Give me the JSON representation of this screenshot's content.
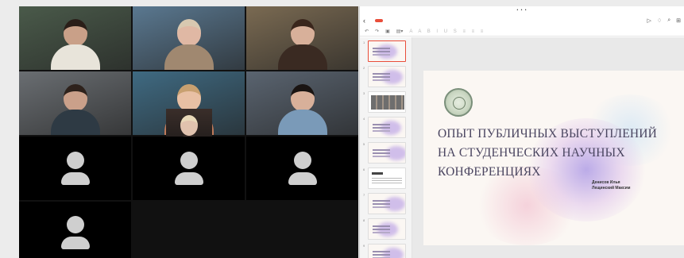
{
  "call": {
    "tiles": [
      {
        "type": "video",
        "name": "",
        "bg": "#4a5a4a",
        "skin": "#c9a088",
        "shirt": "#e8e4da",
        "hair": "#2a1e18"
      },
      {
        "type": "video",
        "name": "",
        "bg": "#5a7890",
        "skin": "#e0b8a4",
        "shirt": "#a08870",
        "hair": "#d8c8b0"
      },
      {
        "type": "video",
        "name": "",
        "bg": "#7a6a52",
        "skin": "#d8b09a",
        "shirt": "#3a2a22",
        "hair": "#3a261c"
      },
      {
        "type": "video",
        "name": "",
        "bg": "#6a6e72",
        "skin": "#caa08a",
        "shirt": "#2e3a44",
        "hair": "#2e221c"
      },
      {
        "type": "video",
        "name": "",
        "bg": "#3f6a82",
        "skin": "#e8c0a4",
        "shirt": "#c07a5a",
        "hair": "#c8a070"
      },
      {
        "type": "video",
        "name": "",
        "bg": "#5a6470",
        "skin": "#d8b09a",
        "shirt": "#7a9ab8",
        "hair": "#1a1412"
      },
      {
        "type": "photo",
        "name": "",
        "bg": "#2a4a6a",
        "skin": "#b8a090",
        "shirt": "#f0f0f0",
        "hair": "#2a2020"
      },
      {
        "type": "avatar",
        "name": ""
      },
      {
        "type": "photo",
        "name": "",
        "bg": "#3a2e2a",
        "skin": "#e0c2ae",
        "shirt": "#4a3a34",
        "hair": "#e8d8b8"
      },
      {
        "type": "avatar",
        "name": ""
      },
      {
        "type": "avatar",
        "name": ""
      },
      {
        "type": "avatar",
        "name": ""
      }
    ]
  },
  "app": {
    "accent": "#e94d3a",
    "tabs": [
      ""
    ],
    "thumbnails": [
      {
        "num": "1",
        "style": "title",
        "selected": true
      },
      {
        "num": "2",
        "style": "soft"
      },
      {
        "num": "3",
        "style": "photos"
      },
      {
        "num": "4",
        "style": "soft"
      },
      {
        "num": "5",
        "style": "soft"
      },
      {
        "num": "6",
        "style": "text"
      },
      {
        "num": "7",
        "style": "soft"
      },
      {
        "num": "8",
        "style": "soft"
      },
      {
        "num": "9",
        "style": "soft"
      }
    ]
  },
  "slide": {
    "title_lines": [
      "ОПЫТ ПУБЛИЧНЫХ ВЫСТУПЛЕНИЙ",
      "НА СТУДЕНЧЕСКИХ НАУЧНЫХ",
      "КОНФЕРЕНЦИЯХ"
    ],
    "authors_lines": [
      "Денисов Илья",
      "Лещинский Максим"
    ],
    "colors": {
      "background": "#fbf7f3",
      "title": "#4a4560"
    }
  }
}
